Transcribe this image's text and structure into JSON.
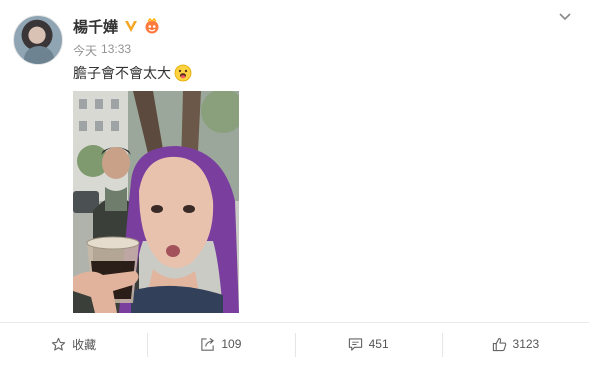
{
  "post": {
    "username": "楊千嬅",
    "time_day": "今天",
    "time_clock": "13:33",
    "text": "膽子會不會太大",
    "verified_icon": "verified-v-icon",
    "badge_icon": "member-badge-icon",
    "emoji_icon": "tongue-out-emoji-icon"
  },
  "actions": {
    "favorite_label": "收藏",
    "repost_count": "109",
    "comment_count": "451",
    "like_count": "3123"
  },
  "colors": {
    "accent_vip": "#f5a623",
    "muted_text": "#939393",
    "divider": "#eaeaea"
  }
}
